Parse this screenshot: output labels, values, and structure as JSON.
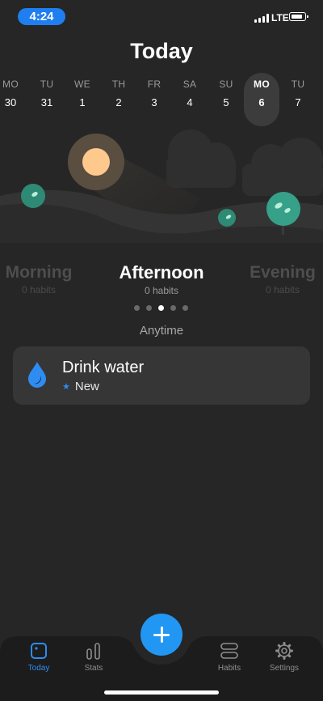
{
  "status": {
    "time": "4:24",
    "network": "LTE"
  },
  "header": {
    "title": "Today"
  },
  "week": [
    {
      "dow": "MO",
      "num": "30"
    },
    {
      "dow": "TU",
      "num": "31"
    },
    {
      "dow": "WE",
      "num": "1"
    },
    {
      "dow": "TH",
      "num": "2"
    },
    {
      "dow": "FR",
      "num": "3"
    },
    {
      "dow": "SA",
      "num": "4"
    },
    {
      "dow": "SU",
      "num": "5"
    },
    {
      "dow": "MO",
      "num": "6",
      "selected": true
    },
    {
      "dow": "TU",
      "num": "7"
    }
  ],
  "periods": [
    {
      "name": "Morning",
      "count": "0 habits"
    },
    {
      "name": "Afternoon",
      "count": "0 habits",
      "active": true
    },
    {
      "name": "Evening",
      "count": "0 habits"
    }
  ],
  "pager": {
    "pages": 5,
    "active_index": 2
  },
  "section": {
    "label": "Anytime"
  },
  "habit": {
    "title": "Drink water",
    "tag": "New",
    "icon": "water-drop-icon",
    "tag_icon": "star-icon"
  },
  "tabs": [
    {
      "label": "Today",
      "icon": "today-icon",
      "active": true
    },
    {
      "label": "Stats",
      "icon": "stats-icon"
    },
    {
      "label": "Habits",
      "icon": "habits-icon"
    },
    {
      "label": "Settings",
      "icon": "gear-icon"
    }
  ],
  "fab": {
    "icon": "plus-icon"
  },
  "colors": {
    "background": "#262626",
    "accent": "#2196f3",
    "card": "#363636",
    "tree": "#2e8a74"
  }
}
